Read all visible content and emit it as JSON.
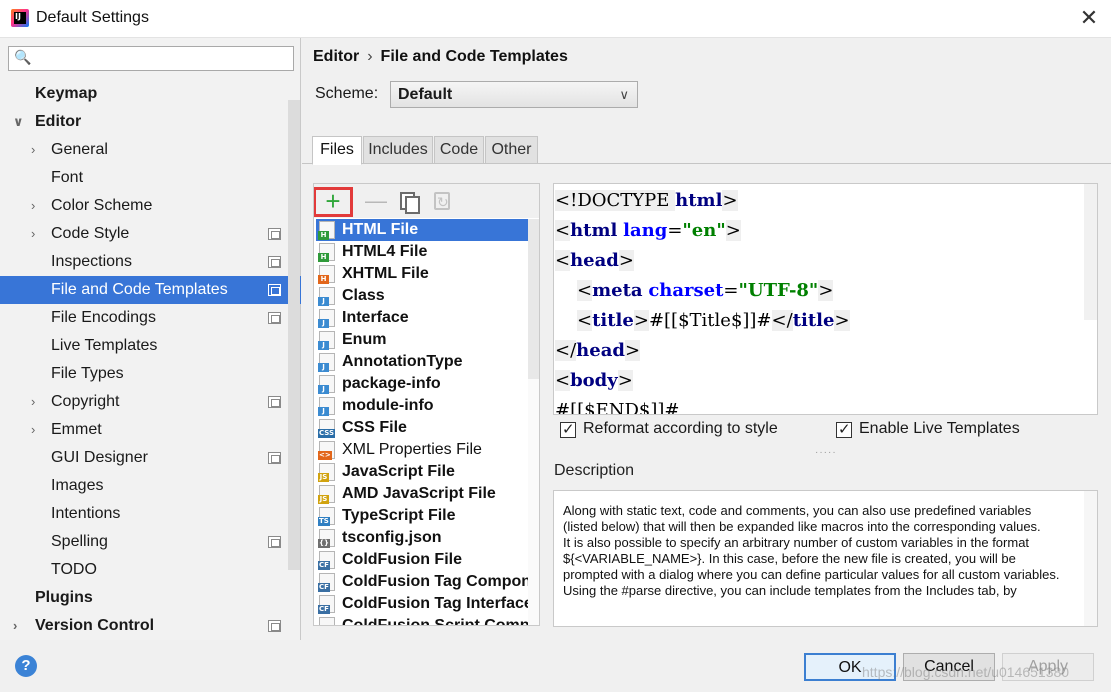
{
  "window": {
    "title": "Default Settings",
    "app_icon_text": "IJ",
    "close_glyph": "✕"
  },
  "sidebar": {
    "search_placeholder": "",
    "search_icon_glyph": "🔍",
    "items": [
      {
        "label": "Keymap",
        "level": 0,
        "bold": true,
        "chevron": "",
        "selected": false,
        "project": false
      },
      {
        "label": "Editor",
        "level": 0,
        "bold": true,
        "chevron": "∨",
        "selected": false,
        "project": false
      },
      {
        "label": "General",
        "level": 1,
        "bold": false,
        "chevron": "›",
        "selected": false,
        "project": false
      },
      {
        "label": "Font",
        "level": 1,
        "bold": false,
        "chevron": "",
        "selected": false,
        "project": false
      },
      {
        "label": "Color Scheme",
        "level": 1,
        "bold": false,
        "chevron": "›",
        "selected": false,
        "project": false
      },
      {
        "label": "Code Style",
        "level": 1,
        "bold": false,
        "chevron": "›",
        "selected": false,
        "project": true
      },
      {
        "label": "Inspections",
        "level": 1,
        "bold": false,
        "chevron": "",
        "selected": false,
        "project": true
      },
      {
        "label": "File and Code Templates",
        "level": 1,
        "bold": false,
        "chevron": "",
        "selected": true,
        "project": true
      },
      {
        "label": "File Encodings",
        "level": 1,
        "bold": false,
        "chevron": "",
        "selected": false,
        "project": true
      },
      {
        "label": "Live Templates",
        "level": 1,
        "bold": false,
        "chevron": "",
        "selected": false,
        "project": false
      },
      {
        "label": "File Types",
        "level": 1,
        "bold": false,
        "chevron": "",
        "selected": false,
        "project": false
      },
      {
        "label": "Copyright",
        "level": 1,
        "bold": false,
        "chevron": "›",
        "selected": false,
        "project": true
      },
      {
        "label": "Emmet",
        "level": 1,
        "bold": false,
        "chevron": "›",
        "selected": false,
        "project": false
      },
      {
        "label": "GUI Designer",
        "level": 1,
        "bold": false,
        "chevron": "",
        "selected": false,
        "project": true
      },
      {
        "label": "Images",
        "level": 1,
        "bold": false,
        "chevron": "",
        "selected": false,
        "project": false
      },
      {
        "label": "Intentions",
        "level": 1,
        "bold": false,
        "chevron": "",
        "selected": false,
        "project": false
      },
      {
        "label": "Spelling",
        "level": 1,
        "bold": false,
        "chevron": "",
        "selected": false,
        "project": true
      },
      {
        "label": "TODO",
        "level": 1,
        "bold": false,
        "chevron": "",
        "selected": false,
        "project": false
      },
      {
        "label": "Plugins",
        "level": 0,
        "bold": true,
        "chevron": "",
        "selected": false,
        "project": false
      },
      {
        "label": "Version Control",
        "level": 0,
        "bold": true,
        "chevron": "›",
        "selected": false,
        "project": true
      }
    ]
  },
  "breadcrumb": {
    "parent": "Editor",
    "separator": "›",
    "current": "File and Code Templates"
  },
  "scheme": {
    "label": "Scheme:",
    "value": "Default",
    "caret": "∨"
  },
  "tabs": [
    {
      "label": "Files",
      "active": true
    },
    {
      "label": "Includes",
      "active": false
    },
    {
      "label": "Code",
      "active": false
    },
    {
      "label": "Other",
      "active": false
    }
  ],
  "toolbar": {
    "add_glyph": "+",
    "remove_glyph": "—"
  },
  "templates": [
    {
      "name": "HTML File",
      "badge": "H",
      "badge_color": "#2f9a3a",
      "bold": true,
      "selected": true
    },
    {
      "name": "HTML4 File",
      "badge": "H",
      "badge_color": "#2f9a3a",
      "bold": true,
      "selected": false
    },
    {
      "name": "XHTML File",
      "badge": "H",
      "badge_color": "#e2661a",
      "bold": true,
      "selected": false
    },
    {
      "name": "Class",
      "badge": "J",
      "badge_color": "#3b8bd1",
      "bold": true,
      "selected": false
    },
    {
      "name": "Interface",
      "badge": "J",
      "badge_color": "#3b8bd1",
      "bold": true,
      "selected": false
    },
    {
      "name": "Enum",
      "badge": "J",
      "badge_color": "#3b8bd1",
      "bold": true,
      "selected": false
    },
    {
      "name": "AnnotationType",
      "badge": "J",
      "badge_color": "#3b8bd1",
      "bold": true,
      "selected": false
    },
    {
      "name": "package-info",
      "badge": "J",
      "badge_color": "#3b8bd1",
      "bold": true,
      "selected": false
    },
    {
      "name": "module-info",
      "badge": "J",
      "badge_color": "#3b8bd1",
      "bold": true,
      "selected": false
    },
    {
      "name": "CSS File",
      "badge": "CSS",
      "badge_color": "#2b6ea8",
      "bold": true,
      "selected": false
    },
    {
      "name": "XML Properties File",
      "badge": "<>",
      "badge_color": "#e2661a",
      "bold": false,
      "selected": false
    },
    {
      "name": "JavaScript File",
      "badge": "JS",
      "badge_color": "#d1a30f",
      "bold": true,
      "selected": false
    },
    {
      "name": "AMD JavaScript File",
      "badge": "JS",
      "badge_color": "#d1a30f",
      "bold": true,
      "selected": false
    },
    {
      "name": "TypeScript File",
      "badge": "TS",
      "badge_color": "#2f7fc2",
      "bold": true,
      "selected": false
    },
    {
      "name": "tsconfig.json",
      "badge": "{}",
      "badge_color": "#6f6f6f",
      "bold": true,
      "selected": false
    },
    {
      "name": "ColdFusion File",
      "badge": "CF",
      "badge_color": "#3a6fa3",
      "bold": true,
      "selected": false
    },
    {
      "name": "ColdFusion Tag Componer",
      "badge": "CF",
      "badge_color": "#3a6fa3",
      "bold": true,
      "selected": false
    },
    {
      "name": "ColdFusion Tag Interface",
      "badge": "CF",
      "badge_color": "#3a6fa3",
      "bold": true,
      "selected": false
    },
    {
      "name": "ColdFusion Script Compon",
      "badge": "CF",
      "badge_color": "#3a6fa3",
      "bold": true,
      "selected": false
    }
  ],
  "code": {
    "lines": [
      {
        "indent": 0,
        "parts": [
          [
            "<!DOCTYPE ",
            "hl"
          ],
          [
            "html",
            "tg"
          ],
          [
            ">",
            "hl"
          ]
        ]
      },
      {
        "indent": 0,
        "parts": [
          [
            "<",
            "hl"
          ],
          [
            "html",
            "tg"
          ],
          [
            " ",
            ""
          ],
          [
            "lang",
            "at"
          ],
          [
            "=",
            ""
          ],
          [
            "\"en\"",
            "vl"
          ],
          [
            ">",
            "hl"
          ]
        ]
      },
      {
        "indent": 0,
        "parts": [
          [
            "<",
            "hl"
          ],
          [
            "head",
            "tg"
          ],
          [
            ">",
            "hl"
          ]
        ]
      },
      {
        "indent": 1,
        "parts": [
          [
            "<",
            "hl"
          ],
          [
            "meta",
            "tg"
          ],
          [
            " ",
            ""
          ],
          [
            "charset",
            "at"
          ],
          [
            "=",
            ""
          ],
          [
            "\"UTF-8\"",
            "vl"
          ],
          [
            ">",
            "hl"
          ]
        ]
      },
      {
        "indent": 1,
        "parts": [
          [
            "<",
            "hl"
          ],
          [
            "title",
            "tg"
          ],
          [
            ">",
            "hl"
          ],
          [
            "#[[$Title$]]#",
            ""
          ],
          [
            "</",
            "hl"
          ],
          [
            "title",
            "tg"
          ],
          [
            ">",
            "hl"
          ]
        ]
      },
      {
        "indent": 0,
        "parts": [
          [
            "</",
            "hl"
          ],
          [
            "head",
            "tg"
          ],
          [
            ">",
            "hl"
          ]
        ]
      },
      {
        "indent": 0,
        "parts": [
          [
            "<",
            "hl"
          ],
          [
            "body",
            "tg"
          ],
          [
            ">",
            "hl"
          ]
        ]
      },
      {
        "indent": 0,
        "parts": [
          [
            "#[[$END$]]#",
            ""
          ]
        ]
      }
    ]
  },
  "options": {
    "reformat_label": "Reformat according to style",
    "reformat_checked": true,
    "live_templates_label": "Enable Live Templates",
    "live_templates_checked": true
  },
  "description": {
    "title": "Description",
    "paragraphs": [
      "Along with static text, code and comments, you can also use predefined variables (listed below) that will then be expanded like macros into the corresponding values.",
      "It is also possible to specify an arbitrary number of custom variables in the format ${<VARIABLE_NAME>}. In this case, before the new file is created, you will be prompted with a dialog where you can define particular values for all custom variables.",
      "Using the #parse directive, you can include templates from the Includes tab, by"
    ]
  },
  "buttons": {
    "ok": "OK",
    "cancel": "Cancel",
    "apply": "Apply",
    "help": "?"
  },
  "watermark": "https://blog.csdn.net/u014651380"
}
